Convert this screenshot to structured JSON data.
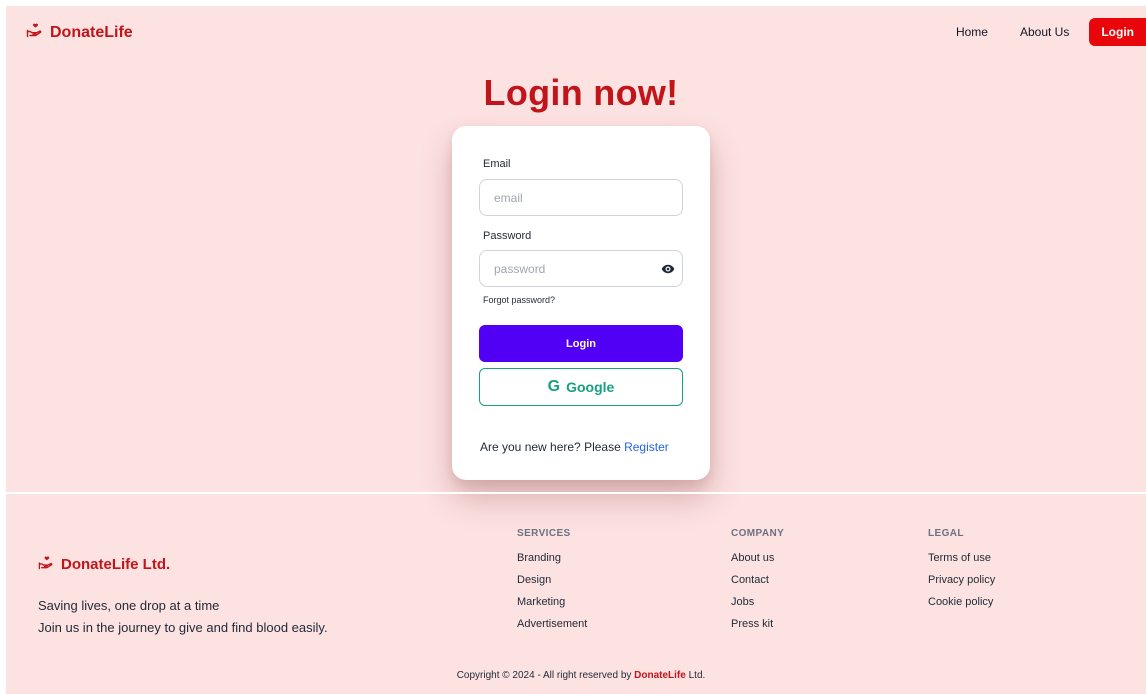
{
  "navbar": {
    "brand": "DonateLife",
    "links": [
      {
        "label": "Home"
      },
      {
        "label": "About Us"
      }
    ],
    "login_label": "Login"
  },
  "hero": {
    "title": "Login now!"
  },
  "form": {
    "email_label": "Email",
    "email_placeholder": "email",
    "password_label": "Password",
    "password_placeholder": "password",
    "forgot_label": "Forgot password?",
    "login_button": "Login",
    "google_letter": "G",
    "google_label": "Google",
    "register_prompt": "Are you new here? Please ",
    "register_link": "Register"
  },
  "footer": {
    "brand": "DonateLife Ltd.",
    "tagline_1": "Saving lives, one drop at a time",
    "tagline_2": "Join us in the journey to give and find blood easily.",
    "columns": [
      {
        "title": "SERVICES",
        "items": [
          "Branding",
          "Design",
          "Marketing",
          "Advertisement"
        ]
      },
      {
        "title": "COMPANY",
        "items": [
          "About us",
          "Contact",
          "Jobs",
          "Press kit"
        ]
      },
      {
        "title": "LEGAL",
        "items": [
          "Terms of use",
          "Privacy policy",
          "Cookie policy"
        ]
      }
    ],
    "copyright_prefix": "Copyright © 2024 - All right reserved by ",
    "copyright_brand": "DonateLife",
    "copyright_suffix": " Ltd."
  },
  "colors": {
    "background": "#fde2e2",
    "brand_red": "#c0151a",
    "login_nav": "#e8060b",
    "login_button": "#5200f5",
    "google_green": "#17a082",
    "link_blue": "#2563eb"
  },
  "icons": {
    "brand": "hand-heart-icon",
    "password_toggle": "eye-icon"
  }
}
